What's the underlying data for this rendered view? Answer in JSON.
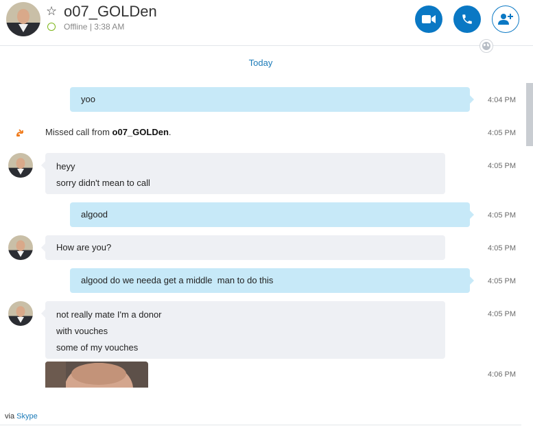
{
  "header": {
    "title": "o07_GOLDen",
    "status": "Offline",
    "separator": "|",
    "last_seen": "3:38 AM",
    "accent": "#0a78c4"
  },
  "date_divider": "Today",
  "messages": [
    {
      "type": "outgoing",
      "text": "yoo",
      "time": "4:04 PM"
    },
    {
      "type": "missed_call",
      "prefix": "Missed call from ",
      "name": "o07_GOLDen",
      "suffix": ".",
      "time": "4:05 PM"
    },
    {
      "type": "incoming",
      "lines": [
        "heyy",
        "sorry didn't mean to call"
      ],
      "time": "4:05 PM"
    },
    {
      "type": "outgoing",
      "text": "algood",
      "time": "4:05 PM"
    },
    {
      "type": "incoming",
      "lines": [
        "How are you?"
      ],
      "time": "4:05 PM"
    },
    {
      "type": "outgoing",
      "text": "algood do we needa get a middle  man to do this",
      "time": "4:05 PM"
    },
    {
      "type": "incoming",
      "lines": [
        "not really mate I'm a donor",
        "with vouches",
        "some of my vouches"
      ],
      "time": "4:05 PM"
    },
    {
      "type": "incoming_image",
      "time": "4:06 PM"
    }
  ],
  "footer": {
    "via": "via",
    "service": "Skype"
  }
}
